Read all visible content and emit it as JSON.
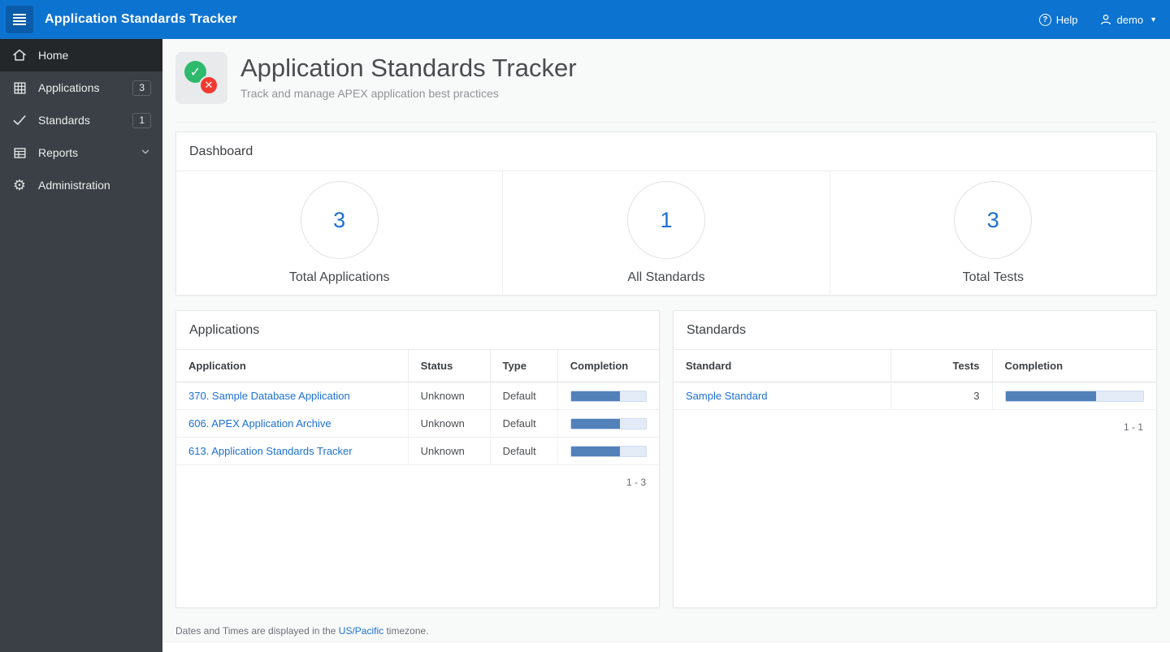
{
  "topbar": {
    "title": "Application Standards Tracker",
    "help_label": "Help",
    "user_label": "demo"
  },
  "sidebar": {
    "items": [
      {
        "label": "Home",
        "icon": "home-icon",
        "active": true
      },
      {
        "label": "Applications",
        "icon": "grid-icon",
        "badge": "3"
      },
      {
        "label": "Standards",
        "icon": "check-icon",
        "badge": "1"
      },
      {
        "label": "Reports",
        "icon": "table-icon",
        "expandable": true
      },
      {
        "label": "Administration",
        "icon": "gear-icon"
      }
    ]
  },
  "page": {
    "title": "Application Standards Tracker",
    "subtitle": "Track and manage APEX application best practices"
  },
  "dashboard": {
    "title": "Dashboard",
    "badges": [
      {
        "value": "3",
        "label": "Total Applications"
      },
      {
        "value": "1",
        "label": "All Standards"
      },
      {
        "value": "3",
        "label": "Total Tests"
      }
    ]
  },
  "applications": {
    "title": "Applications",
    "columns": {
      "application": "Application",
      "status": "Status",
      "type": "Type",
      "completion": "Completion"
    },
    "rows": [
      {
        "application": "370. Sample Database Application",
        "status": "Unknown",
        "type": "Default",
        "completion_pct": 65
      },
      {
        "application": "606. APEX Application Archive",
        "status": "Unknown",
        "type": "Default",
        "completion_pct": 65
      },
      {
        "application": "613. Application Standards Tracker",
        "status": "Unknown",
        "type": "Default",
        "completion_pct": 65
      }
    ],
    "pagination": "1 - 3"
  },
  "standards": {
    "title": "Standards",
    "columns": {
      "standard": "Standard",
      "tests": "Tests",
      "completion": "Completion"
    },
    "rows": [
      {
        "standard": "Sample Standard",
        "tests": "3",
        "completion_pct": 66
      }
    ],
    "pagination": "1 - 1"
  },
  "footer": {
    "text_before": "Dates and Times are displayed in the ",
    "link": "US/Pacific",
    "text_after": " timezone."
  },
  "colors": {
    "header_bg": "#0d73d0",
    "sidebar_bg": "#3a4045",
    "sidebar_active_bg": "#232729",
    "accent_blue": "#1c6fd4",
    "link": "#1c70d3",
    "progress_fill": "#5281ba",
    "progress_track": "#e3ebf7",
    "icon_green": "#2dba6c",
    "icon_red": "#f23a30"
  }
}
